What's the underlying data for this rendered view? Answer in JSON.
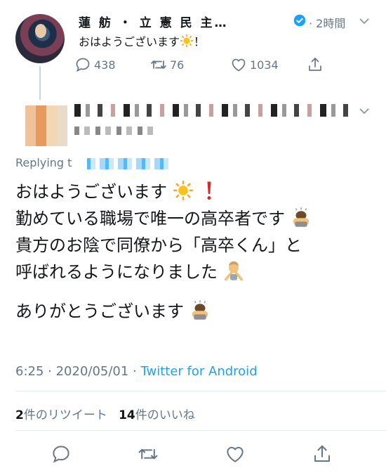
{
  "parent_tweet": {
    "display_name": "蓮 舫 ・ 立 憲 民 主…",
    "time_ago": "2時間",
    "text": "おはようございます",
    "text_suffix": "！",
    "counts": {
      "replies": "438",
      "retweets": "76",
      "likes": "1034"
    }
  },
  "reply_header": {
    "replying_label": "Replying t"
  },
  "main_tweet": {
    "lines": [
      "おはようございます",
      "勤めている職場で唯一の高卒者です",
      "貴方のお陰で同僚から「高卒くん」と",
      "呼ばれるようになりました",
      "ありがとうございます"
    ],
    "meta_time": "6:25 · 2020/05/01 · ",
    "source": "Twitter for Android",
    "retweet_count": "2",
    "retweet_label": "件のリツイート",
    "like_count": "14",
    "like_label": "件のいいね"
  },
  "colors": {
    "accent": "#1da1f2",
    "muted": "#657786",
    "text": "#14171a"
  },
  "icons": [
    "verified-icon",
    "chevron-down-icon",
    "reply-icon",
    "retweet-icon",
    "like-icon",
    "share-icon",
    "sun-emoji",
    "exclamation-emoji",
    "bowing-emoji",
    "no-gesture-emoji"
  ]
}
